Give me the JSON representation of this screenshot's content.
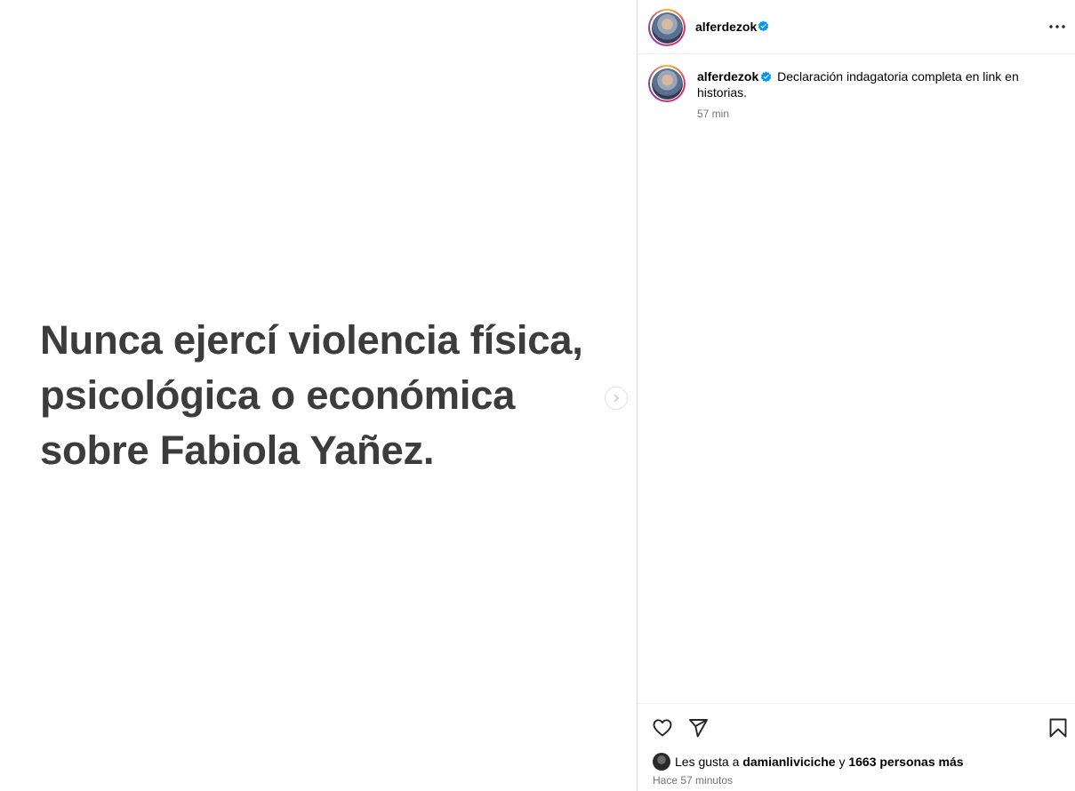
{
  "media": {
    "text_lines": [
      "Nunca ejercí violencia física,",
      "psicológica o económica",
      "sobre Fabiola Yañez."
    ]
  },
  "header": {
    "username": "alferdezok"
  },
  "caption": {
    "username": "alferdezok",
    "text": "Declaración indagatoria completa en link en historias.",
    "time": "57 min"
  },
  "likes": {
    "prefix": "Les gusta a",
    "user": "damianliviciche",
    "conj": "y",
    "others": "1663 personas más"
  },
  "posted_time": "Hace 57 minutos",
  "colors": {
    "verified": "#0095f6",
    "media_text": "#3c3c3c",
    "secondary_text": "#737373",
    "divider": "#dbdbdb"
  },
  "icons": [
    "chevron-right-icon",
    "more-icon",
    "verified-icon",
    "heart-icon",
    "send-icon",
    "bookmark-icon"
  ]
}
